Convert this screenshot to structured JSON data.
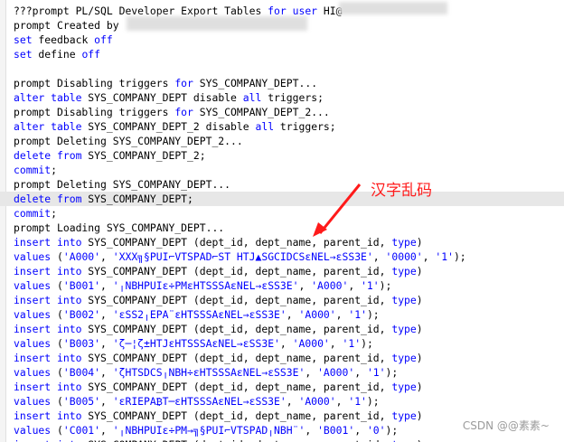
{
  "lines": [
    {
      "segments": [
        {
          "t": "???prompt PL/SQL Developer Export Tables ",
          "c": "plain"
        },
        {
          "t": "for",
          "c": "kw"
        },
        {
          "t": " ",
          "c": "plain"
        },
        {
          "t": "user",
          "c": "kw"
        },
        {
          "t": " HI@",
          "c": "plain"
        },
        {
          "t": "RCLPDB1",
          "c": "plain",
          "pad": 278
        }
      ]
    },
    {
      "segments": [
        {
          "t": "prompt Created by",
          "c": "plain"
        }
      ]
    },
    {
      "segments": [
        {
          "t": "set",
          "c": "kw"
        },
        {
          "t": " feedback ",
          "c": "plain"
        },
        {
          "t": "off",
          "c": "kw"
        }
      ]
    },
    {
      "segments": [
        {
          "t": "set",
          "c": "kw"
        },
        {
          "t": " define ",
          "c": "plain"
        },
        {
          "t": "off",
          "c": "kw"
        }
      ]
    },
    {
      "segments": []
    },
    {
      "segments": [
        {
          "t": "prompt Disabling triggers ",
          "c": "plain"
        },
        {
          "t": "for",
          "c": "kw"
        },
        {
          "t": " SYS_COMPANY_DEPT...",
          "c": "plain"
        }
      ]
    },
    {
      "segments": [
        {
          "t": "alter",
          "c": "kw"
        },
        {
          "t": " ",
          "c": "plain"
        },
        {
          "t": "table",
          "c": "kw"
        },
        {
          "t": " SYS_COMPANY_DEPT disable ",
          "c": "plain"
        },
        {
          "t": "all",
          "c": "kw"
        },
        {
          "t": " triggers;",
          "c": "plain"
        }
      ]
    },
    {
      "segments": [
        {
          "t": "prompt Disabling triggers ",
          "c": "plain"
        },
        {
          "t": "for",
          "c": "kw"
        },
        {
          "t": " SYS_COMPANY_DEPT_2...",
          "c": "plain"
        }
      ]
    },
    {
      "segments": [
        {
          "t": "alter",
          "c": "kw"
        },
        {
          "t": " ",
          "c": "plain"
        },
        {
          "t": "table",
          "c": "kw"
        },
        {
          "t": " SYS_COMPANY_DEPT_2 disable ",
          "c": "plain"
        },
        {
          "t": "all",
          "c": "kw"
        },
        {
          "t": " triggers;",
          "c": "plain"
        }
      ]
    },
    {
      "segments": [
        {
          "t": "prompt Deleting SYS_COMPANY_DEPT_2...",
          "c": "plain"
        }
      ]
    },
    {
      "segments": [
        {
          "t": "delete",
          "c": "kw"
        },
        {
          "t": " ",
          "c": "plain"
        },
        {
          "t": "from",
          "c": "kw"
        },
        {
          "t": " SYS_COMPANY_DEPT_2;",
          "c": "plain"
        }
      ]
    },
    {
      "segments": [
        {
          "t": "commit",
          "c": "kw"
        },
        {
          "t": ";",
          "c": "plain"
        }
      ]
    },
    {
      "segments": [
        {
          "t": "prompt Deleting SYS_COMPANY_DEPT...",
          "c": "plain"
        }
      ]
    },
    {
      "current": true,
      "segments": [
        {
          "t": "delete",
          "c": "kw"
        },
        {
          "t": " ",
          "c": "plain"
        },
        {
          "t": "from",
          "c": "kw"
        },
        {
          "t": " SYS_COMPANY_DEPT;",
          "c": "plain"
        }
      ]
    },
    {
      "segments": [
        {
          "t": "commit",
          "c": "kw"
        },
        {
          "t": ";",
          "c": "plain"
        }
      ]
    },
    {
      "segments": [
        {
          "t": "prompt Loading SYS_COMPANY_DEPT...",
          "c": "plain"
        }
      ]
    },
    {
      "segments": [
        {
          "t": "insert",
          "c": "kw"
        },
        {
          "t": " ",
          "c": "plain"
        },
        {
          "t": "into",
          "c": "kw"
        },
        {
          "t": " SYS_COMPANY_DEPT (dept_id, dept_name, parent_id, ",
          "c": "plain"
        },
        {
          "t": "type",
          "c": "kw"
        },
        {
          "t": ")",
          "c": "plain"
        }
      ]
    },
    {
      "segments": [
        {
          "t": "values",
          "c": "kw"
        },
        {
          "t": " (",
          "c": "plain"
        },
        {
          "t": "'A000'",
          "c": "str"
        },
        {
          "t": ", ",
          "c": "plain"
        },
        {
          "t": "'XXX╗§PUI⌐VTSPAD⌐ST HTJ▲SGCIDCSεNEL→εSS3E'",
          "c": "str"
        },
        {
          "t": ", ",
          "c": "plain"
        },
        {
          "t": "'0000'",
          "c": "str"
        },
        {
          "t": ", ",
          "c": "plain"
        },
        {
          "t": "'1'",
          "c": "str"
        },
        {
          "t": ");",
          "c": "plain"
        }
      ]
    },
    {
      "segments": [
        {
          "t": "insert",
          "c": "kw"
        },
        {
          "t": " ",
          "c": "plain"
        },
        {
          "t": "into",
          "c": "kw"
        },
        {
          "t": " SYS_COMPANY_DEPT (dept_id, dept_name, parent_id, ",
          "c": "plain"
        },
        {
          "t": "type",
          "c": "kw"
        },
        {
          "t": ")",
          "c": "plain"
        }
      ]
    },
    {
      "segments": [
        {
          "t": "values",
          "c": "kw"
        },
        {
          "t": " (",
          "c": "plain"
        },
        {
          "t": "'B001'",
          "c": "str"
        },
        {
          "t": ", ",
          "c": "plain"
        },
        {
          "t": "'╷NBHPUIε÷PMεHTSSSAεNEL→εSS3E'",
          "c": "str"
        },
        {
          "t": ", ",
          "c": "plain"
        },
        {
          "t": "'A000'",
          "c": "str"
        },
        {
          "t": ", ",
          "c": "plain"
        },
        {
          "t": "'1'",
          "c": "str"
        },
        {
          "t": ");",
          "c": "plain"
        }
      ]
    },
    {
      "segments": [
        {
          "t": "insert",
          "c": "kw"
        },
        {
          "t": " ",
          "c": "plain"
        },
        {
          "t": "into",
          "c": "kw"
        },
        {
          "t": " SYS_COMPANY_DEPT (dept_id, dept_name, parent_id, ",
          "c": "plain"
        },
        {
          "t": "type",
          "c": "kw"
        },
        {
          "t": ")",
          "c": "plain"
        }
      ]
    },
    {
      "segments": [
        {
          "t": "values",
          "c": "kw"
        },
        {
          "t": " (",
          "c": "plain"
        },
        {
          "t": "'B002'",
          "c": "str"
        },
        {
          "t": ", ",
          "c": "plain"
        },
        {
          "t": "'εSS2╷EPA¨εHTSSSAεNEL→εSS3E'",
          "c": "str"
        },
        {
          "t": ", ",
          "c": "plain"
        },
        {
          "t": "'A000'",
          "c": "str"
        },
        {
          "t": ", ",
          "c": "plain"
        },
        {
          "t": "'1'",
          "c": "str"
        },
        {
          "t": ");",
          "c": "plain"
        }
      ]
    },
    {
      "segments": [
        {
          "t": "insert",
          "c": "kw"
        },
        {
          "t": " ",
          "c": "plain"
        },
        {
          "t": "into",
          "c": "kw"
        },
        {
          "t": " SYS_COMPANY_DEPT (dept_id, dept_name, parent_id, ",
          "c": "plain"
        },
        {
          "t": "type",
          "c": "kw"
        },
        {
          "t": ")",
          "c": "plain"
        }
      ]
    },
    {
      "segments": [
        {
          "t": "values",
          "c": "kw"
        },
        {
          "t": " (",
          "c": "plain"
        },
        {
          "t": "'B003'",
          "c": "str"
        },
        {
          "t": ", ",
          "c": "plain"
        },
        {
          "t": "'ζ─¦ζ±HTJεHTSSSAεNEL→εSS3E'",
          "c": "str"
        },
        {
          "t": ", ",
          "c": "plain"
        },
        {
          "t": "'A000'",
          "c": "str"
        },
        {
          "t": ", ",
          "c": "plain"
        },
        {
          "t": "'1'",
          "c": "str"
        },
        {
          "t": ");",
          "c": "plain"
        }
      ]
    },
    {
      "segments": [
        {
          "t": "insert",
          "c": "kw"
        },
        {
          "t": " ",
          "c": "plain"
        },
        {
          "t": "into",
          "c": "kw"
        },
        {
          "t": " SYS_COMPANY_DEPT (dept_id, dept_name, parent_id, ",
          "c": "plain"
        },
        {
          "t": "type",
          "c": "kw"
        },
        {
          "t": ")",
          "c": "plain"
        }
      ]
    },
    {
      "segments": [
        {
          "t": "values",
          "c": "kw"
        },
        {
          "t": " (",
          "c": "plain"
        },
        {
          "t": "'B004'",
          "c": "str"
        },
        {
          "t": ", ",
          "c": "plain"
        },
        {
          "t": "'ζHTSDCS╷NBH÷εHTSSSAεNEL→εSS3E'",
          "c": "str"
        },
        {
          "t": ", ",
          "c": "plain"
        },
        {
          "t": "'A000'",
          "c": "str"
        },
        {
          "t": ", ",
          "c": "plain"
        },
        {
          "t": "'1'",
          "c": "str"
        },
        {
          "t": ");",
          "c": "plain"
        }
      ]
    },
    {
      "segments": [
        {
          "t": "insert",
          "c": "kw"
        },
        {
          "t": " ",
          "c": "plain"
        },
        {
          "t": "into",
          "c": "kw"
        },
        {
          "t": " SYS_COMPANY_DEPT (dept_id, dept_name, parent_id, ",
          "c": "plain"
        },
        {
          "t": "type",
          "c": "kw"
        },
        {
          "t": ")",
          "c": "plain"
        }
      ]
    },
    {
      "segments": [
        {
          "t": "values",
          "c": "kw"
        },
        {
          "t": " (",
          "c": "plain"
        },
        {
          "t": "'B005'",
          "c": "str"
        },
        {
          "t": ", ",
          "c": "plain"
        },
        {
          "t": "'εRIEPA₿T─εHTSSSAεNEL→εSS3E'",
          "c": "str"
        },
        {
          "t": ", ",
          "c": "plain"
        },
        {
          "t": "'A000'",
          "c": "str"
        },
        {
          "t": ", ",
          "c": "plain"
        },
        {
          "t": "'1'",
          "c": "str"
        },
        {
          "t": ");",
          "c": "plain"
        }
      ]
    },
    {
      "segments": [
        {
          "t": "insert",
          "c": "kw"
        },
        {
          "t": " ",
          "c": "plain"
        },
        {
          "t": "into",
          "c": "kw"
        },
        {
          "t": " SYS_COMPANY_DEPT (dept_id, dept_name, parent_id, ",
          "c": "plain"
        },
        {
          "t": "type",
          "c": "kw"
        },
        {
          "t": ")",
          "c": "plain"
        }
      ]
    },
    {
      "segments": [
        {
          "t": "values",
          "c": "kw"
        },
        {
          "t": " (",
          "c": "plain"
        },
        {
          "t": "'C001'",
          "c": "str"
        },
        {
          "t": ", ",
          "c": "plain"
        },
        {
          "t": "'╷NBHPUIε÷PM→╗§PUI⌐VTSPAD╷NBH¨'",
          "c": "str"
        },
        {
          "t": ", ",
          "c": "plain"
        },
        {
          "t": "'B001'",
          "c": "str"
        },
        {
          "t": ", ",
          "c": "plain"
        },
        {
          "t": "'0'",
          "c": "str"
        },
        {
          "t": ");",
          "c": "plain"
        }
      ]
    },
    {
      "segments": [
        {
          "t": "insert",
          "c": "kw"
        },
        {
          "t": " ",
          "c": "plain"
        },
        {
          "t": "into",
          "c": "kw"
        },
        {
          "t": " SYS_COMPANY_DEPT (dept_id, dept_name, parent_id, ",
          "c": "plain"
        },
        {
          "t": "type",
          "c": "kw"
        },
        {
          "t": ")",
          "c": "plain"
        }
      ]
    }
  ],
  "annotation": {
    "text": "汉字乱码",
    "color": "#ff1a1a"
  },
  "watermark": "CSDN @@素素~",
  "colors": {
    "keyword": "#0000ff",
    "text": "#000000",
    "current_line": "#e7e7e7",
    "accent": "#ff1a1a"
  }
}
